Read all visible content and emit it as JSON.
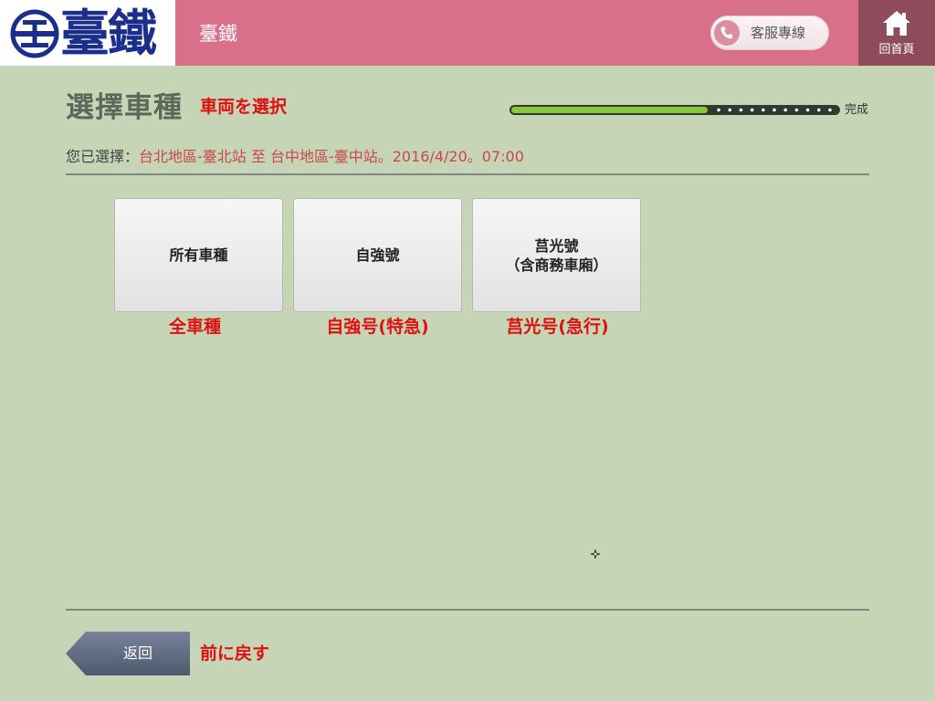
{
  "header": {
    "logo_text": "臺鐵",
    "title": "臺鐵",
    "hotline_label": "客服專線",
    "home_label": "回首頁"
  },
  "icons": {
    "logo": "tr-logo-icon",
    "hotline": "phone-icon",
    "home": "home-icon",
    "cursor": "cursor-crosshair-icon"
  },
  "page": {
    "title": "選擇車種",
    "title_ja": "車両を選択",
    "progress": {
      "fraction": 0.6,
      "done_label": "完成"
    },
    "selection_prefix": "您已選擇：",
    "selection_value": "台北地區-臺北站 至 台中地區-臺中站。2016/4/20。07:00"
  },
  "train_types": [
    {
      "label": "所有車種",
      "sublabel": "",
      "label_ja": "全車種"
    },
    {
      "label": "自強號",
      "sublabel": "",
      "label_ja": "自強号(特急)"
    },
    {
      "label": "莒光號",
      "sublabel": "（含商務車廂）",
      "label_ja": "莒光号(急行)"
    }
  ],
  "footer": {
    "back_label": "返回",
    "back_label_ja": "前に戻す"
  },
  "colors": {
    "page_bg": "#c5d5b5",
    "header_pink": "#d9708a",
    "home_bg": "#8e4b5c",
    "accent_red": "#e01010",
    "selection_red": "#c9474d",
    "progress_green": "#8cc63f",
    "logo_blue": "#1b2e8c"
  }
}
